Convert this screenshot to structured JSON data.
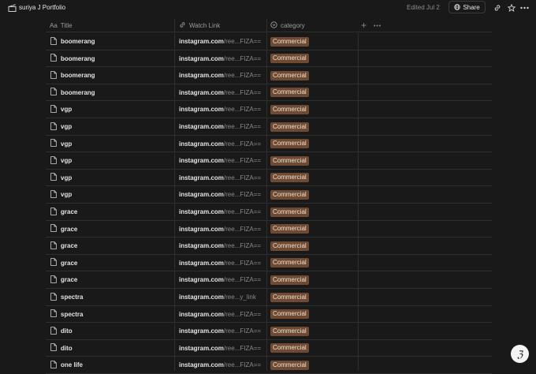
{
  "page": {
    "title": "suriya J Portfolio",
    "edited": "Edited Jul 2",
    "share_label": "Share"
  },
  "table": {
    "columns": [
      {
        "label": "Title",
        "icon": "text-icon"
      },
      {
        "label": "Watch Link",
        "icon": "link-icon"
      },
      {
        "label": "category",
        "icon": "select-icon"
      }
    ],
    "rows": [
      {
        "title": "boomerang",
        "link_main": "instagram.com",
        "link_tail": "/ree...FIZA==",
        "category": "Commercial"
      },
      {
        "title": "boomerang",
        "link_main": "instagram.com",
        "link_tail": "/ree...FIZA==",
        "category": "Commercial"
      },
      {
        "title": "boomerang",
        "link_main": "instagram.com",
        "link_tail": "/ree...FIZA==",
        "category": "Commercial"
      },
      {
        "title": "boomerang",
        "link_main": "instagram.com",
        "link_tail": "/ree...FIZA==",
        "category": "Commercial"
      },
      {
        "title": "vgp",
        "link_main": "instagram.com",
        "link_tail": "/ree...FIZA==",
        "category": "Commercial"
      },
      {
        "title": "vgp",
        "link_main": "instagram.com",
        "link_tail": "/ree...FIZA==",
        "category": "Commercial"
      },
      {
        "title": "vgp",
        "link_main": "instagram.com",
        "link_tail": "/ree...FIZA==",
        "category": "Commercial"
      },
      {
        "title": "vgp",
        "link_main": "instagram.com",
        "link_tail": "/ree...FIZA==",
        "category": "Commercial"
      },
      {
        "title": "vgp",
        "link_main": "instagram.com",
        "link_tail": "/ree...FIZA==",
        "category": "Commercial"
      },
      {
        "title": "vgp",
        "link_main": "instagram.com",
        "link_tail": "/ree...FIZA==",
        "category": "Commercial"
      },
      {
        "title": "grace",
        "link_main": "instagram.com",
        "link_tail": "/ree...FIZA==",
        "category": "Commercial"
      },
      {
        "title": "grace",
        "link_main": "instagram.com",
        "link_tail": "/ree...FIZA==",
        "category": "Commercial"
      },
      {
        "title": "grace",
        "link_main": "instagram.com",
        "link_tail": "/ree...FIZA==",
        "category": "Commercial"
      },
      {
        "title": "grace",
        "link_main": "instagram.com",
        "link_tail": "/ree...FIZA==",
        "category": "Commercial"
      },
      {
        "title": "grace",
        "link_main": "instagram.com",
        "link_tail": "/ree...FIZA==",
        "category": "Commercial"
      },
      {
        "title": "spectra",
        "link_main": "instagram.com",
        "link_tail": "/ree...y_link",
        "category": "Commercial"
      },
      {
        "title": "spectra",
        "link_main": "instagram.com",
        "link_tail": "/ree...FIZA==",
        "category": "Commercial"
      },
      {
        "title": "dito",
        "link_main": "instagram.com",
        "link_tail": "/ree...FIZA==",
        "category": "Commercial"
      },
      {
        "title": "dito",
        "link_main": "instagram.com",
        "link_tail": "/ree...FIZA==",
        "category": "Commercial"
      },
      {
        "title": "one life",
        "link_main": "instagram.com",
        "link_tail": "/ree...FIZA==",
        "category": "Commercial"
      }
    ]
  },
  "colors": {
    "background": "#191919",
    "tag_bg": "#6e4a33",
    "tag_text": "#f0e0d2"
  }
}
